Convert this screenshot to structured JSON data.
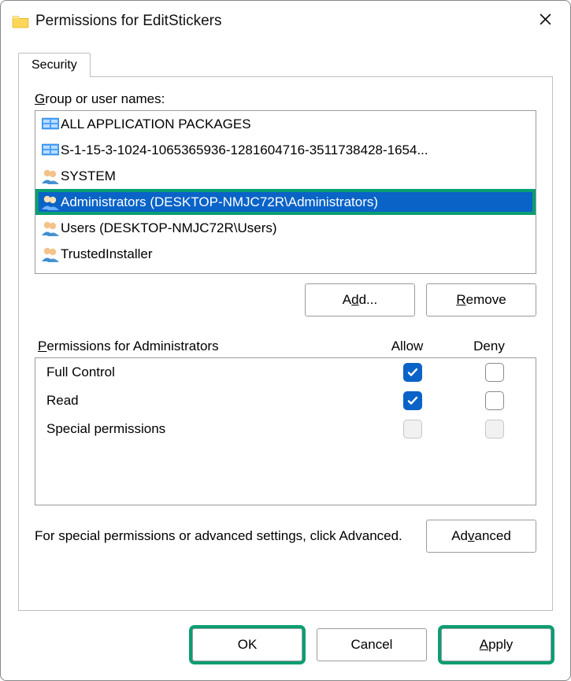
{
  "title": "Permissions for EditStickers",
  "tab": "Security",
  "group_label_pre": "G",
  "group_label_post": "roup or user names:",
  "principals": [
    {
      "icon": "pkg",
      "name": "ALL APPLICATION PACKAGES"
    },
    {
      "icon": "pkg",
      "name": "S-1-15-3-1024-1065365936-1281604716-3511738428-1654..."
    },
    {
      "icon": "users",
      "name": "SYSTEM"
    },
    {
      "icon": "users",
      "name": "Administrators (DESKTOP-NMJC72R\\Administrators)",
      "selected": true,
      "ring": true
    },
    {
      "icon": "users",
      "name": "Users (DESKTOP-NMJC72R\\Users)"
    },
    {
      "icon": "users",
      "name": "TrustedInstaller"
    }
  ],
  "add_label_pre": "A",
  "add_label_u": "d",
  "add_label_post": "d...",
  "remove_label_u": "R",
  "remove_label_post": "emove",
  "perm_header_u": "P",
  "perm_header_post": "ermissions for Administrators",
  "allow_label": "Allow",
  "deny_label": "Deny",
  "perms": [
    {
      "name": "Full Control",
      "allow": "checked",
      "deny": "normal"
    },
    {
      "name": "Read",
      "allow": "checked",
      "deny": "normal"
    },
    {
      "name": "Special permissions",
      "allow": "disabled",
      "deny": "disabled"
    }
  ],
  "footer_text": "For special permissions or advanced settings, click Advanced.",
  "advanced_pre": "Ad",
  "advanced_u": "v",
  "advanced_post": "anced",
  "ok_label": "OK",
  "cancel_label": "Cancel",
  "apply_u": "A",
  "apply_post": "pply"
}
